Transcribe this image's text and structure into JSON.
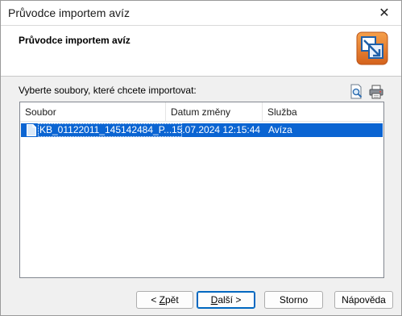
{
  "window": {
    "title": "Průvodce importem avíz",
    "close_glyph": "✕"
  },
  "header": {
    "title": "Průvodce importem avíz",
    "logo_icon": "import-wizard-logo-icon"
  },
  "instruction": "Vyberte soubory, které chcete importovat:",
  "toolbar": {
    "preview_icon": "preview-magnifier-icon",
    "print_icon": "printer-icon"
  },
  "list": {
    "columns": [
      "Soubor",
      "Datum změny",
      "Služba"
    ],
    "rows": [
      {
        "file": "KB_01122011_145142484_P...",
        "date": "15.07.2024 12:15:44",
        "service": "Avíza",
        "selected": true
      }
    ]
  },
  "buttons": {
    "back": {
      "pre": "< ",
      "accel": "Z",
      "post": "pět"
    },
    "next": {
      "pre": "",
      "accel": "D",
      "post": "alší >"
    },
    "cancel": "Storno",
    "help": "Nápověda"
  },
  "colors": {
    "selection": "#0a64d2",
    "accent": "#0067c0"
  }
}
